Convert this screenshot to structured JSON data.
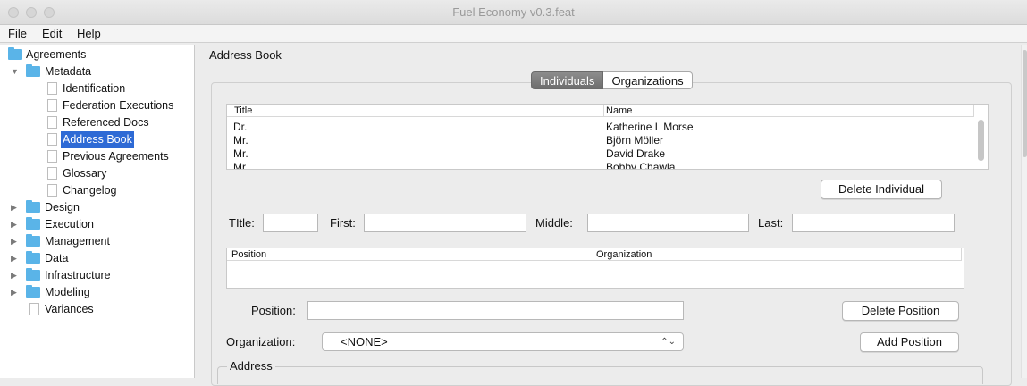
{
  "window": {
    "title": "Fuel Economy v0.3.feat"
  },
  "menu": [
    "File",
    "Edit",
    "Help"
  ],
  "tree": {
    "items": [
      {
        "label": "Agreements",
        "type": "folder",
        "expanded": true
      },
      {
        "label": "Metadata",
        "type": "folder",
        "expanded": true
      },
      {
        "label": "Identification",
        "type": "doc"
      },
      {
        "label": "Federation Executions",
        "type": "doc"
      },
      {
        "label": "Referenced Docs",
        "type": "doc"
      },
      {
        "label": "Address Book",
        "type": "doc",
        "selected": true
      },
      {
        "label": "Previous Agreements",
        "type": "doc"
      },
      {
        "label": "Glossary",
        "type": "doc"
      },
      {
        "label": "Changelog",
        "type": "doc"
      },
      {
        "label": "Design",
        "type": "folder",
        "expanded": false
      },
      {
        "label": "Execution",
        "type": "folder",
        "expanded": false
      },
      {
        "label": "Management",
        "type": "folder",
        "expanded": false
      },
      {
        "label": "Data",
        "type": "folder",
        "expanded": false
      },
      {
        "label": "Infrastructure",
        "type": "folder",
        "expanded": false
      },
      {
        "label": "Modeling",
        "type": "folder",
        "expanded": false
      },
      {
        "label": "Variances",
        "type": "doc"
      }
    ]
  },
  "address_book": {
    "title": "Address Book",
    "tabs": [
      {
        "label": "Individuals",
        "active": true
      },
      {
        "label": "Organizations",
        "active": false
      }
    ],
    "individuals_table": {
      "headers": [
        "Title",
        "Name"
      ],
      "rows": [
        [
          "Dr.",
          "Katherine L Morse"
        ],
        [
          "Mr.",
          "Björn  Möller"
        ],
        [
          "Mr.",
          "David  Drake"
        ],
        [
          "Mr.",
          "Bobby  Chawla"
        ]
      ]
    },
    "delete_individual_label": "Delete Individual",
    "name_fields": {
      "title_label": "TItle:",
      "first_label": "First:",
      "middle_label": "Middle:",
      "last_label": "Last:",
      "title_value": "",
      "first_value": "",
      "middle_value": "",
      "last_value": ""
    },
    "positions_table": {
      "headers": [
        "Position",
        "Organization"
      ],
      "rows": []
    },
    "position_label": "Position:",
    "position_value": "",
    "delete_position_label": "Delete Position",
    "organization_label": "Organization:",
    "organization_selected": "<NONE>",
    "add_position_label": "Add Position",
    "address_legend": "Address"
  },
  "colors": {
    "accent": "#2e6ad5",
    "folder": "#5ab4e8"
  }
}
